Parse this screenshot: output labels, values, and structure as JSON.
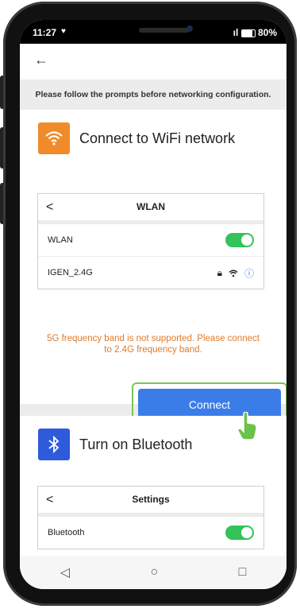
{
  "status_bar": {
    "time": "11:27",
    "battery": "80%"
  },
  "app": {
    "back_label": "←"
  },
  "prompt": "Please follow the prompts before networking configuration.",
  "wifi_section": {
    "title": "Connect to WiFi network",
    "icon": "wifi-icon",
    "icon_color": "#f08b2a",
    "card": {
      "back": "<",
      "title": "WLAN",
      "rows": [
        {
          "label": "WLAN",
          "toggle": true
        },
        {
          "label": "IGEN_2.4G",
          "icons": [
            "lock-icon",
            "wifi-icon",
            "info-icon"
          ]
        }
      ]
    },
    "warning": "5G frequency band is not supported. Please connect to 2.4G frequency band.",
    "connect_label": "Connect"
  },
  "bluetooth_section": {
    "title": "Turn on Bluetooth",
    "icon": "bluetooth-icon",
    "icon_color": "#2d5bdc",
    "card": {
      "back": "<",
      "title": "Settings",
      "rows": [
        {
          "label": "Bluetooth",
          "toggle": true
        }
      ]
    }
  },
  "nav": {
    "back": "◁",
    "home": "○",
    "recent": "□"
  }
}
